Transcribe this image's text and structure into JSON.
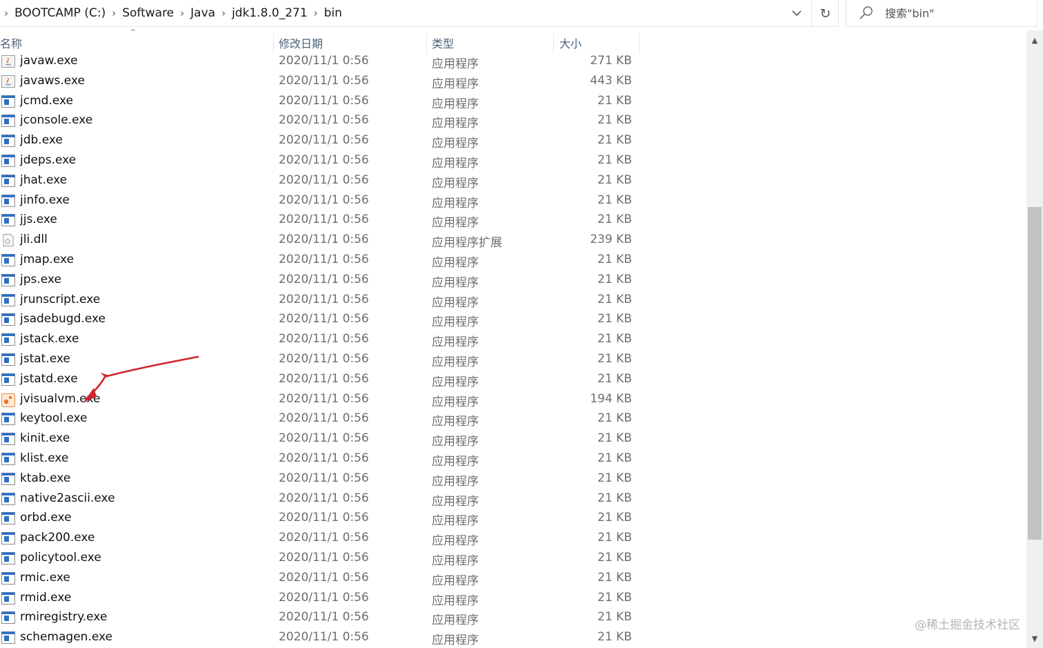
{
  "address_bar": {
    "crumbs": [
      "BOOTCAMP (C:)",
      "Software",
      "Java",
      "jdk1.8.0_271",
      "bin"
    ],
    "refresh_icon": "refresh-icon",
    "dropdown_icon": "chevron-down-icon"
  },
  "search": {
    "placeholder": "搜索\"bin\"",
    "icon": "search-icon"
  },
  "columns": {
    "name": "名称",
    "date": "修改日期",
    "type": "类型",
    "size": "大小"
  },
  "files": [
    {
      "name": "javaw.exe",
      "date": "2020/11/1 0:56",
      "type": "应用程序",
      "size": "271 KB",
      "icon": "java-app-icon"
    },
    {
      "name": "javaws.exe",
      "date": "2020/11/1 0:56",
      "type": "应用程序",
      "size": "443 KB",
      "icon": "java-app-icon"
    },
    {
      "name": "jcmd.exe",
      "date": "2020/11/1 0:56",
      "type": "应用程序",
      "size": "21 KB",
      "icon": "exe-icon"
    },
    {
      "name": "jconsole.exe",
      "date": "2020/11/1 0:56",
      "type": "应用程序",
      "size": "21 KB",
      "icon": "exe-icon"
    },
    {
      "name": "jdb.exe",
      "date": "2020/11/1 0:56",
      "type": "应用程序",
      "size": "21 KB",
      "icon": "exe-icon"
    },
    {
      "name": "jdeps.exe",
      "date": "2020/11/1 0:56",
      "type": "应用程序",
      "size": "21 KB",
      "icon": "exe-icon"
    },
    {
      "name": "jhat.exe",
      "date": "2020/11/1 0:56",
      "type": "应用程序",
      "size": "21 KB",
      "icon": "exe-icon"
    },
    {
      "name": "jinfo.exe",
      "date": "2020/11/1 0:56",
      "type": "应用程序",
      "size": "21 KB",
      "icon": "exe-icon"
    },
    {
      "name": "jjs.exe",
      "date": "2020/11/1 0:56",
      "type": "应用程序",
      "size": "21 KB",
      "icon": "exe-icon"
    },
    {
      "name": "jli.dll",
      "date": "2020/11/1 0:56",
      "type": "应用程序扩展",
      "size": "239 KB",
      "icon": "dll-icon"
    },
    {
      "name": "jmap.exe",
      "date": "2020/11/1 0:56",
      "type": "应用程序",
      "size": "21 KB",
      "icon": "exe-icon"
    },
    {
      "name": "jps.exe",
      "date": "2020/11/1 0:56",
      "type": "应用程序",
      "size": "21 KB",
      "icon": "exe-icon"
    },
    {
      "name": "jrunscript.exe",
      "date": "2020/11/1 0:56",
      "type": "应用程序",
      "size": "21 KB",
      "icon": "exe-icon"
    },
    {
      "name": "jsadebugd.exe",
      "date": "2020/11/1 0:56",
      "type": "应用程序",
      "size": "21 KB",
      "icon": "exe-icon"
    },
    {
      "name": "jstack.exe",
      "date": "2020/11/1 0:56",
      "type": "应用程序",
      "size": "21 KB",
      "icon": "exe-icon"
    },
    {
      "name": "jstat.exe",
      "date": "2020/11/1 0:56",
      "type": "应用程序",
      "size": "21 KB",
      "icon": "exe-icon"
    },
    {
      "name": "jstatd.exe",
      "date": "2020/11/1 0:56",
      "type": "应用程序",
      "size": "21 KB",
      "icon": "exe-icon"
    },
    {
      "name": "jvisualvm.exe",
      "date": "2020/11/1 0:56",
      "type": "应用程序",
      "size": "194 KB",
      "icon": "visualvm-icon"
    },
    {
      "name": "keytool.exe",
      "date": "2020/11/1 0:56",
      "type": "应用程序",
      "size": "21 KB",
      "icon": "exe-icon"
    },
    {
      "name": "kinit.exe",
      "date": "2020/11/1 0:56",
      "type": "应用程序",
      "size": "21 KB",
      "icon": "exe-icon"
    },
    {
      "name": "klist.exe",
      "date": "2020/11/1 0:56",
      "type": "应用程序",
      "size": "21 KB",
      "icon": "exe-icon"
    },
    {
      "name": "ktab.exe",
      "date": "2020/11/1 0:56",
      "type": "应用程序",
      "size": "21 KB",
      "icon": "exe-icon"
    },
    {
      "name": "native2ascii.exe",
      "date": "2020/11/1 0:56",
      "type": "应用程序",
      "size": "21 KB",
      "icon": "exe-icon"
    },
    {
      "name": "orbd.exe",
      "date": "2020/11/1 0:56",
      "type": "应用程序",
      "size": "21 KB",
      "icon": "exe-icon"
    },
    {
      "name": "pack200.exe",
      "date": "2020/11/1 0:56",
      "type": "应用程序",
      "size": "21 KB",
      "icon": "exe-icon"
    },
    {
      "name": "policytool.exe",
      "date": "2020/11/1 0:56",
      "type": "应用程序",
      "size": "21 KB",
      "icon": "exe-icon"
    },
    {
      "name": "rmic.exe",
      "date": "2020/11/1 0:56",
      "type": "应用程序",
      "size": "21 KB",
      "icon": "exe-icon"
    },
    {
      "name": "rmid.exe",
      "date": "2020/11/1 0:56",
      "type": "应用程序",
      "size": "21 KB",
      "icon": "exe-icon"
    },
    {
      "name": "rmiregistry.exe",
      "date": "2020/11/1 0:56",
      "type": "应用程序",
      "size": "21 KB",
      "icon": "exe-icon"
    },
    {
      "name": "schemagen.exe",
      "date": "2020/11/1 0:56",
      "type": "应用程序",
      "size": "21 KB",
      "icon": "exe-icon"
    }
  ],
  "annotation": {
    "arrow_color": "#d0252a",
    "target": "jvisualvm.exe"
  },
  "watermark": "@稀土掘金技术社区",
  "colors": {
    "header_text": "#4c607a",
    "meta_text": "#6d6d6d",
    "scrollbar_thumb": "#c2c2c2"
  }
}
